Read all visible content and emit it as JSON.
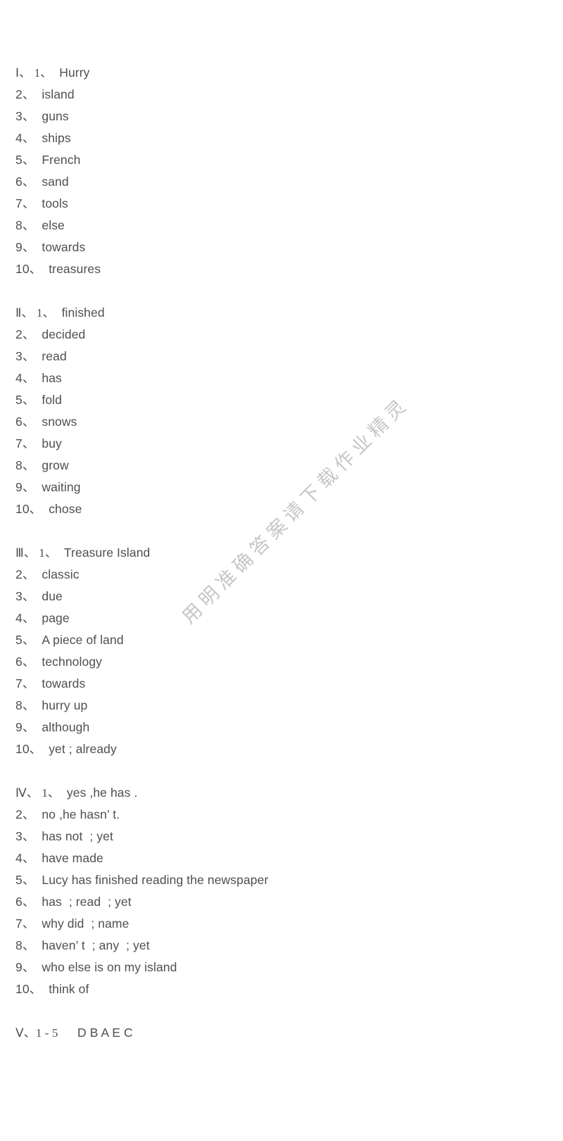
{
  "document": {
    "type": "answer-key",
    "text_color": "#4f4f4f",
    "background_color": "#ffffff"
  },
  "watermark": {
    "text": "用明准确答案请下载作业精灵",
    "color": "#c4c4c4",
    "rotation": "-45deg"
  },
  "sections": [
    {
      "label": "Ⅰ、",
      "first_number": "1、",
      "lines": [
        {
          "num": "Ⅰ、 1、",
          "text": "Hurry"
        },
        {
          "num": "2、",
          "text": "island"
        },
        {
          "num": "3、",
          "text": "guns"
        },
        {
          "num": "4、",
          "text": "ships"
        },
        {
          "num": "5、",
          "text": "French"
        },
        {
          "num": "6、",
          "text": "sand"
        },
        {
          "num": "7、",
          "text": "tools"
        },
        {
          "num": "8、",
          "text": "else"
        },
        {
          "num": "9、",
          "text": "towards"
        },
        {
          "num": "10、",
          "text": "treasures"
        }
      ]
    },
    {
      "label": "Ⅱ、",
      "first_number": "1、",
      "lines": [
        {
          "num": "Ⅱ、 1、",
          "text": "finished"
        },
        {
          "num": "2、",
          "text": "decided"
        },
        {
          "num": "3、",
          "text": "read"
        },
        {
          "num": "4、",
          "text": "has"
        },
        {
          "num": "5、",
          "text": "fold"
        },
        {
          "num": "6、",
          "text": "snows"
        },
        {
          "num": "7、",
          "text": "buy"
        },
        {
          "num": "8、",
          "text": "grow"
        },
        {
          "num": "9、",
          "text": "waiting"
        },
        {
          "num": "10、",
          "text": "chose"
        }
      ]
    },
    {
      "label": "Ⅲ、",
      "first_number": "1、",
      "lines": [
        {
          "num": "Ⅲ、 1、",
          "text": "Treasure Island"
        },
        {
          "num": "2、",
          "text": "classic"
        },
        {
          "num": "3、",
          "text": "due"
        },
        {
          "num": "4、",
          "text": "page"
        },
        {
          "num": "5、",
          "text": "A piece of land"
        },
        {
          "num": "6、",
          "text": "technology"
        },
        {
          "num": "7、",
          "text": "towards"
        },
        {
          "num": "8、",
          "text": "hurry up"
        },
        {
          "num": "9、",
          "text": "although"
        },
        {
          "num": "10、",
          "text": "yet ; already"
        }
      ]
    },
    {
      "label": "Ⅳ、",
      "first_number": "1、",
      "lines": [
        {
          "num": "Ⅳ、 1、",
          "text": "yes ,he has ."
        },
        {
          "num": "2、",
          "text": "no ,he hasn’ t."
        },
        {
          "num": "3、",
          "text": "has not  ; yet"
        },
        {
          "num": "4、",
          "text": "have made"
        },
        {
          "num": "5、",
          "text": "Lucy has finished reading the newspaper"
        },
        {
          "num": "6、",
          "text": "has  ; read  ; yet"
        },
        {
          "num": "7、",
          "text": "why did  ; name"
        },
        {
          "num": "8、",
          "text": "haven’ t  ; any  ; yet"
        },
        {
          "num": "9、",
          "text": "who else is on my island"
        },
        {
          "num": "10、",
          "text": "think of"
        }
      ]
    },
    {
      "label": "Ⅴ、",
      "first_number": "1 - 5",
      "lines": [
        {
          "num": "Ⅴ、1 - 5",
          "text": "　D B A E C"
        }
      ]
    }
  ]
}
